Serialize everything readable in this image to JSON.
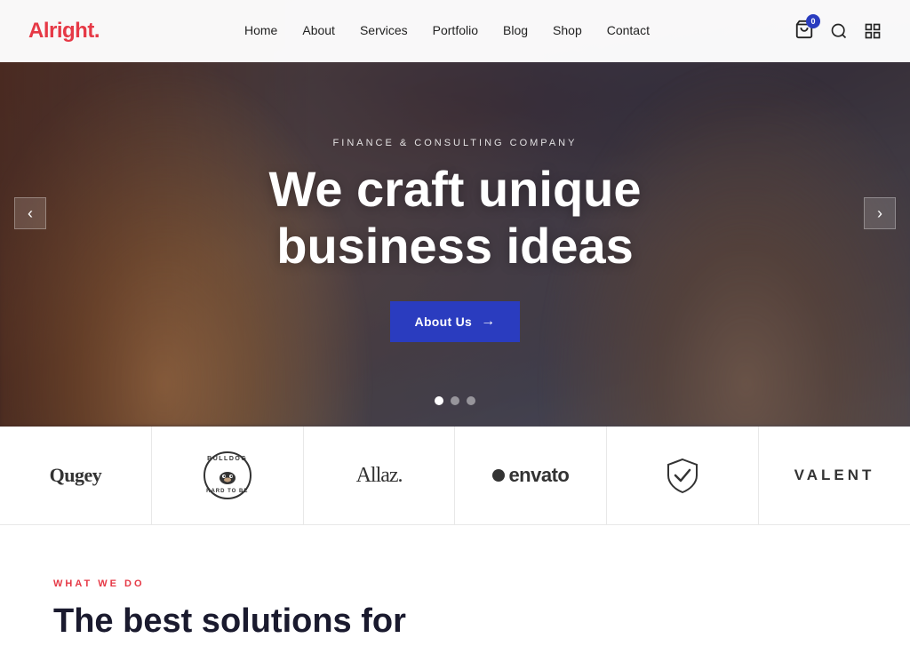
{
  "site": {
    "logo_text": "Alright",
    "logo_dot": ".",
    "nav_items": [
      "Home",
      "About",
      "Services",
      "Portfolio",
      "Blog",
      "Shop",
      "Contact"
    ],
    "cart_count": "0"
  },
  "hero": {
    "subtitle": "Finance & Consulting Company",
    "title_line1": "We craft unique",
    "title_line2": "business ideas",
    "cta_label": "About Us",
    "dots": [
      "active",
      "",
      ""
    ],
    "arrow_left": "‹",
    "arrow_right": "›"
  },
  "logos": [
    {
      "id": "qugey",
      "display": "Qugey",
      "type": "text"
    },
    {
      "id": "bulldog",
      "display": "BULLDOG\nHARD TO BE",
      "type": "circle"
    },
    {
      "id": "allaz",
      "display": "Allaz.",
      "type": "text-serif"
    },
    {
      "id": "envato",
      "display": "envato",
      "type": "envato"
    },
    {
      "id": "shield",
      "display": "shield",
      "type": "shield"
    },
    {
      "id": "valent",
      "display": "VALENT",
      "type": "text-spaced"
    }
  ],
  "what_we_do": {
    "label": "What We Do",
    "title_line1": "The best solutions for"
  }
}
